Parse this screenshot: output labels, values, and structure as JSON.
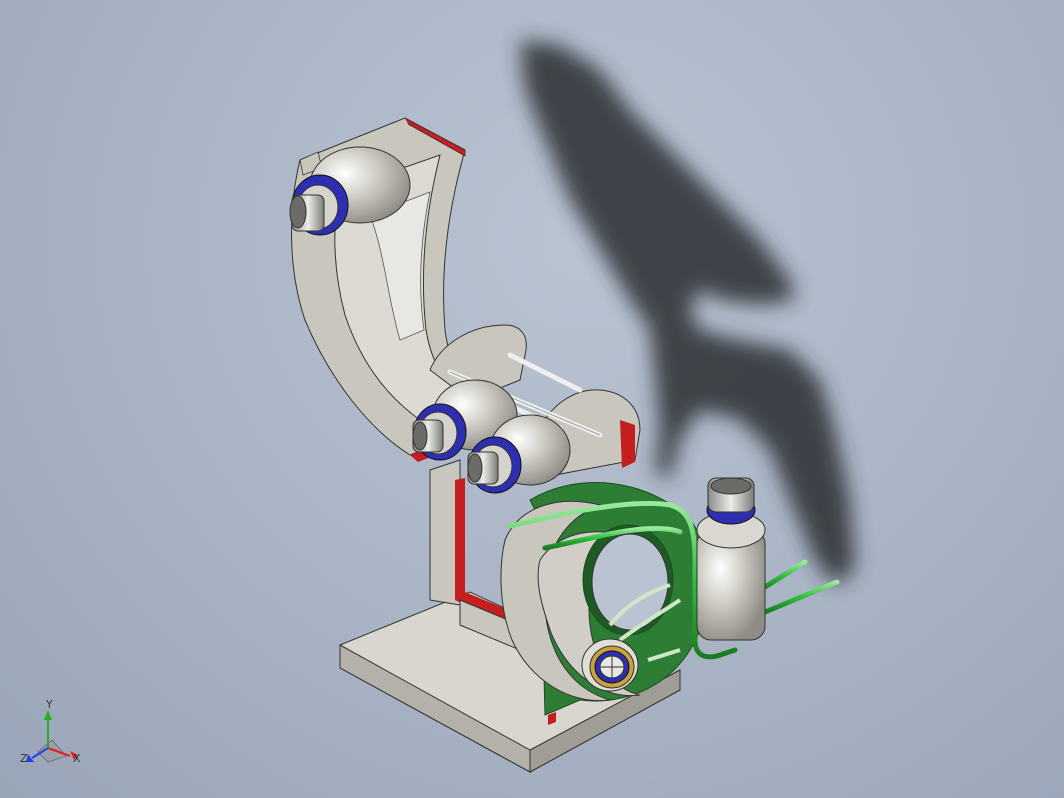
{
  "viewport": {
    "background_top": "#b9c3d2",
    "background_bottom": "#99a5b8"
  },
  "colors": {
    "body_gray": "#c8c6bd",
    "body_gray_dark": "#a9a79f",
    "section_red": "#c41e1e",
    "tube_green": "#2fbf3a",
    "plate_green": "#2e7d35",
    "ring_blue": "#2d2fb0",
    "shadow": "#2a2e33"
  },
  "triad": {
    "x_label": "X",
    "y_label": "Y",
    "z_label": "Z",
    "x_color": "#e02020",
    "y_color": "#20b020",
    "z_color": "#2040e0"
  }
}
